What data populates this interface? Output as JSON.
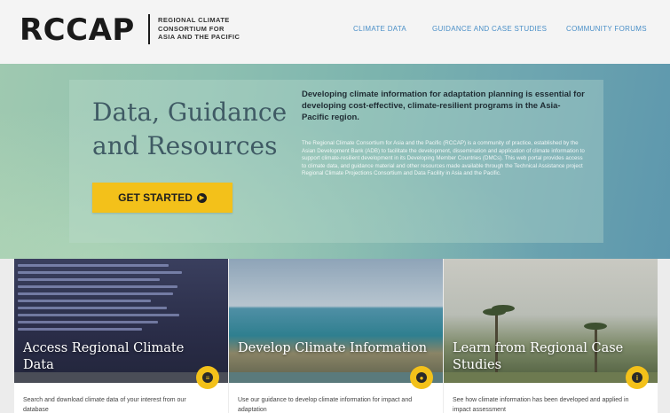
{
  "header": {
    "logo": "RCCAP",
    "org_lines": [
      "REGIONAL CLIMATE",
      "CONSORTIUM FOR",
      "ASIA AND THE PACIFIC"
    ],
    "nav": [
      {
        "label": "CLIMATE DATA"
      },
      {
        "label": "GUIDANCE AND CASE STUDIES"
      },
      {
        "label": "COMMUNITY FORUMS"
      }
    ]
  },
  "hero": {
    "title": "Data, Guidance and Resources",
    "cta_label": "GET STARTED",
    "cta_icon": "arrow-circle-right-icon",
    "lead": "Developing climate information for adaptation planning is essential for developing cost-effective, climate-resilient programs in the Asia-Pacific region.",
    "body": "The Regional Climate Consortium for Asia and the Pacific (RCCAP) is a community of practice, established by the Asian Development Bank (ADB) to facilitate the development, dissemination and application of climate information to support climate-resilient development in its Developing Member Countries (DMCs). This web portal provides access to climate data, and guidance material and other resources made available through the Technical Assistance project Regional Climate Projections Consortium and Data Facility in Asia and the Pacific."
  },
  "cards": [
    {
      "title": "Access Regional Climate Data",
      "text": "Search and download climate data of your interest from our database",
      "icon": "database-icon"
    },
    {
      "title": "Develop Climate Information",
      "text": "Use our guidance to develop climate information for impact and adaptation",
      "icon": "map-pin-icon"
    },
    {
      "title": "Learn from Regional Case Studies",
      "text": "See how climate information has been developed and applied in impact assessment",
      "icon": "info-icon"
    }
  ],
  "colors": {
    "accent": "#f3c11a",
    "nav_link": "#4a8fc7"
  }
}
